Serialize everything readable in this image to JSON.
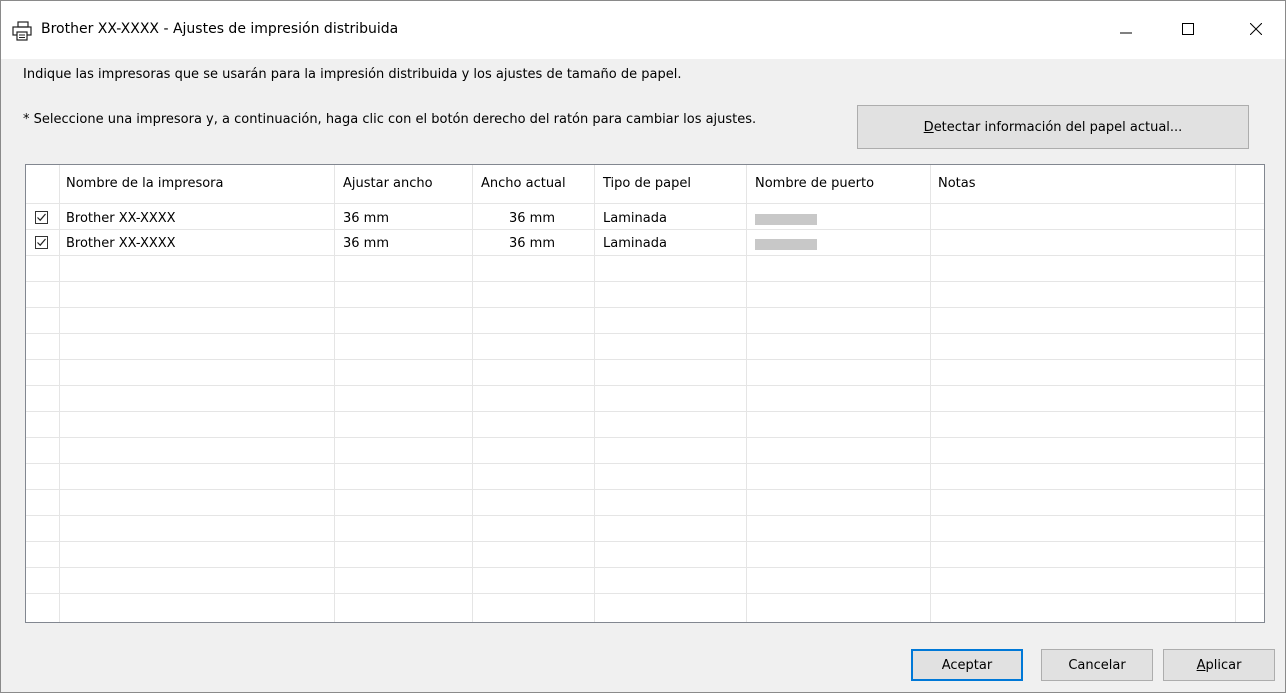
{
  "window": {
    "title": "Brother XX-XXXX - Ajustes de impresión distribuida"
  },
  "instructions": "Indique las impresoras que se usarán para la impresión distribuida y los ajustes de tamaño de papel.",
  "note": "* Seleccione una impresora y, a continuación, haga clic con el botón derecho del ratón para cambiar los ajustes.",
  "detect_button": {
    "label_first": "D",
    "label_rest": "etectar información del papel actual..."
  },
  "table": {
    "columns": [
      "Nombre de la impresora",
      "Ajustar ancho",
      "Ancho actual",
      "Tipo de papel",
      "Nombre de puerto",
      "Notas"
    ],
    "rows": [
      {
        "checked": true,
        "name": "Brother XX-XXXX",
        "set_width": "36 mm",
        "actual_width": "36 mm",
        "paper_type": "Laminada",
        "port": "",
        "notes": ""
      },
      {
        "checked": true,
        "name": "Brother XX-XXXX",
        "set_width": "36 mm",
        "actual_width": "36 mm",
        "paper_type": "Laminada",
        "port": "",
        "notes": ""
      }
    ]
  },
  "buttons": {
    "accept": "Aceptar",
    "cancel": "Cancelar",
    "apply_first": "A",
    "apply_rest": "plicar"
  },
  "icons": {
    "title": "printer-icon",
    "minimize": "minimize-icon",
    "maximize": "maximize-icon",
    "close": "close-icon",
    "check": "checkbox-checked-icon"
  },
  "colors": {
    "default_button_border": "#0078d7",
    "titlebar": "#ffffff",
    "dialog": "#f0f0f0"
  }
}
